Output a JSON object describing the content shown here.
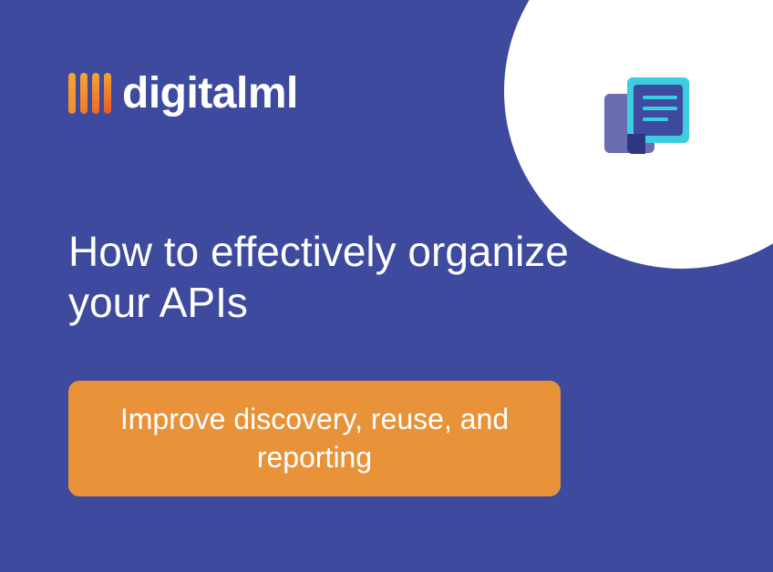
{
  "logo": {
    "brand_name": "digitalml"
  },
  "headline": "How to effectively organize your APIs",
  "cta": {
    "label": "Improve discovery, reuse, and reporting"
  },
  "colors": {
    "background": "#3d4a9e",
    "accent": "#e8933a",
    "circle": "#ffffff",
    "icon_cyan": "#3dcde0",
    "icon_purple": "#6b6db0"
  }
}
